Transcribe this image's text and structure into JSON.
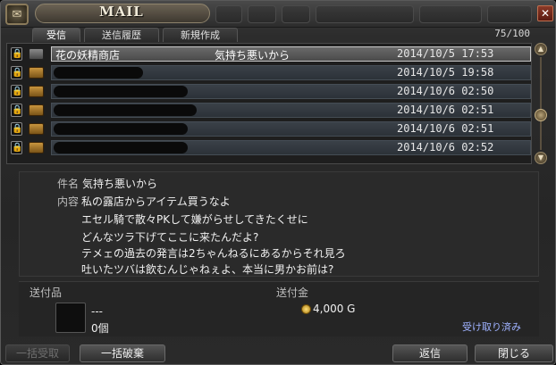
{
  "window": {
    "title": "MAIL"
  },
  "tabs": [
    {
      "label": "受信"
    },
    {
      "label": "送信履歴"
    },
    {
      "label": "新規作成"
    }
  ],
  "mail_count": "75/100",
  "mails": [
    {
      "sender": "花の妖精商店",
      "subject": "気持ち悪いから",
      "date": "2014/10/5 17:53"
    },
    {
      "sender": "",
      "subject": "",
      "date": "2014/10/5 19:58"
    },
    {
      "sender": "",
      "subject": "",
      "date": "2014/10/6 02:50"
    },
    {
      "sender": "",
      "subject": "",
      "date": "2014/10/6 02:51"
    },
    {
      "sender": "",
      "subject": "",
      "date": "2014/10/6 02:51"
    },
    {
      "sender": "",
      "subject": "",
      "date": "2014/10/6 02:52"
    }
  ],
  "detail": {
    "subject_label": "件名",
    "subject": "気持ち悪いから",
    "content_label": "内容",
    "body": [
      "私の露店からアイテム買うなよ",
      "エセル騎で散々PKして嫌がらせしてきたくせに",
      "どんなツラ下げてここに来たんだよ?",
      "テメェの過去の発言は2ちゃんねるにあるからそれ見ろ",
      "吐いたツバは飲むんじゃねぇよ、本当に男かお前は?"
    ]
  },
  "attachment": {
    "item_label": "送付品",
    "item_name": "---",
    "item_count": "0個",
    "gold_label": "送付金",
    "gold": "4,000 G",
    "received_status": "受け取り済み"
  },
  "buttons": {
    "bulk_receive": "一括受取",
    "bulk_delete": "一括破棄",
    "reply": "返信",
    "close": "閉じる"
  }
}
